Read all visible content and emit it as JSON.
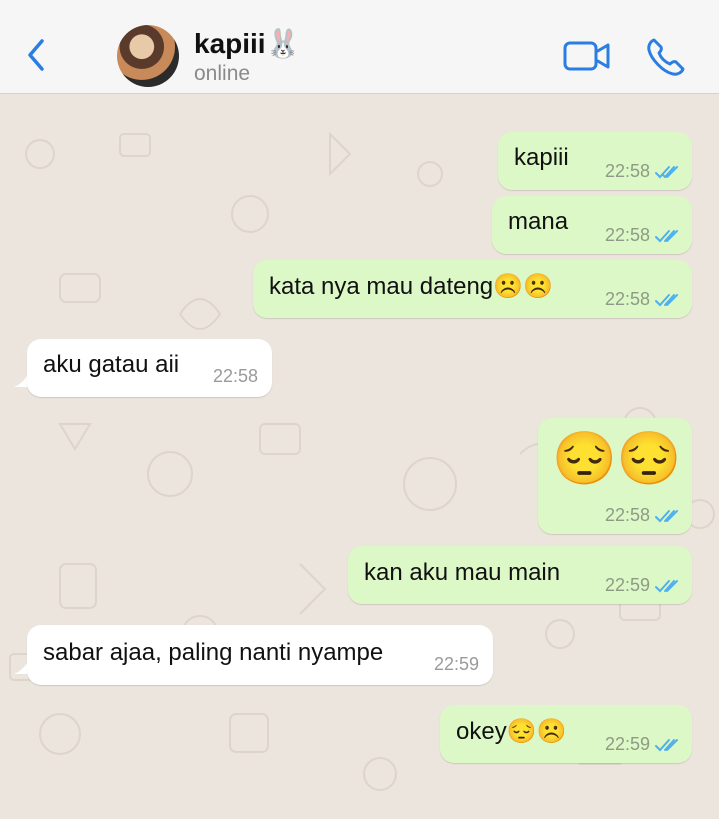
{
  "header": {
    "contact_name": "kapiii🐰",
    "status": "online",
    "back_icon": "chevron-left-icon",
    "video_icon": "video-camera-icon",
    "call_icon": "phone-icon",
    "accent_color": "#2a7de1"
  },
  "messages": [
    {
      "direction": "out",
      "text": "kapiii",
      "time": "22:58",
      "read": true
    },
    {
      "direction": "out",
      "text": "mana",
      "time": "22:58",
      "read": true
    },
    {
      "direction": "out",
      "text": "kata nya mau dateng☹️☹️",
      "time": "22:58",
      "read": true
    },
    {
      "direction": "in",
      "text": "aku gatau aii",
      "time": "22:58"
    },
    {
      "direction": "out",
      "text": "😔😔",
      "time": "22:58",
      "read": true
    },
    {
      "direction": "out",
      "text": "kan aku mau main",
      "time": "22:59",
      "read": true
    },
    {
      "direction": "in",
      "text": "sabar ajaa, paling nanti nyampe",
      "time": "22:59"
    },
    {
      "direction": "out",
      "text": "okey😔☹️",
      "time": "22:59",
      "read": true
    }
  ],
  "colors": {
    "outgoing_bubble": "#dcf8c6",
    "incoming_bubble": "#ffffff",
    "read_tick": "#4fb0ec",
    "wallpaper": "#ece5dd"
  }
}
